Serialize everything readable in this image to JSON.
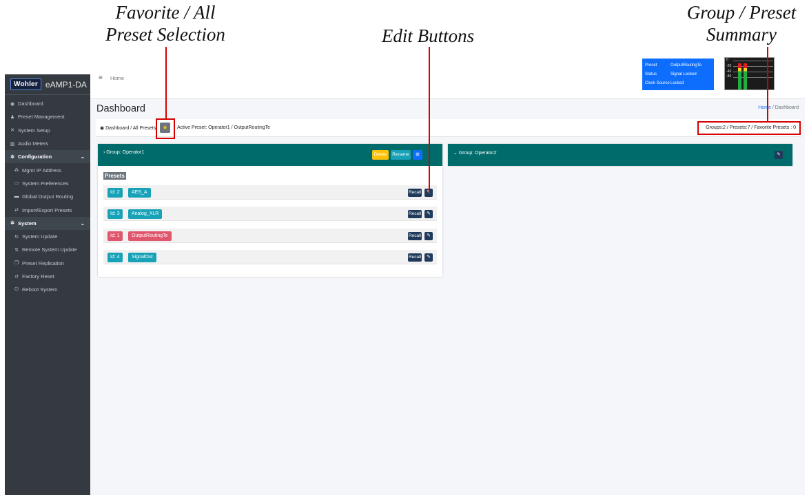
{
  "annotations": {
    "favorite_line1": "Favorite / All",
    "favorite_line2": "Preset Selection",
    "edit": "Edit Buttons",
    "summary_line1": "Group / Preset",
    "summary_line2": "Summary"
  },
  "brand": {
    "logo": "Wohler",
    "product": "eAMP1-DA"
  },
  "sidebar": {
    "items": [
      {
        "label": "Dashboard",
        "icon": "dashboard-icon",
        "glyph": "◉"
      },
      {
        "label": "Preset Management",
        "icon": "users-icon",
        "glyph": "♟"
      },
      {
        "label": "System Setup",
        "icon": "tools-icon",
        "glyph": "✕"
      },
      {
        "label": "Audio Meters",
        "icon": "chart-icon",
        "glyph": "▥"
      }
    ],
    "configuration": {
      "label": "Configuration",
      "items": [
        {
          "label": "Mgmt IP Address",
          "icon": "network-icon",
          "glyph": "⁂"
        },
        {
          "label": "System Preferences",
          "icon": "toggle-icon",
          "glyph": "▭"
        },
        {
          "label": "Global Output Routing",
          "icon": "keyboard-icon",
          "glyph": "▬"
        },
        {
          "label": "Import/Export Presets",
          "icon": "exchange-icon",
          "glyph": "⇄"
        }
      ]
    },
    "system": {
      "label": "System",
      "items": [
        {
          "label": "System Update",
          "icon": "sync-icon",
          "glyph": "↻"
        },
        {
          "label": "Remote System Update",
          "icon": "tower-icon",
          "glyph": "⇅"
        },
        {
          "label": "Preset Replication",
          "icon": "copy-icon",
          "glyph": "❐"
        },
        {
          "label": "Factory Reset",
          "icon": "undo-icon",
          "glyph": "↺"
        },
        {
          "label": "Reboot System",
          "icon": "power-icon",
          "glyph": "⏻"
        }
      ]
    }
  },
  "topbar": {
    "home": "Home"
  },
  "status": {
    "preset_label": "Preset",
    "preset_value": "OutputRoutingTe",
    "status_label": "Status",
    "status_value": "Signal Locked",
    "clock_label": "Clock Source",
    "clock_value": "Locked"
  },
  "meter": {
    "labels": [
      "0",
      "-20",
      "-40",
      "-80"
    ],
    "left_level": 0.82,
    "right_level": 0.82
  },
  "page": {
    "title": "Dashboard",
    "crumb_home": "Home",
    "crumb_sep": " / ",
    "crumb_current": "Dashboard"
  },
  "infobar": {
    "breadcrumb": "Dashboard / All Presets",
    "active_preset": "Active Preset: Operator1 / OutputRoutingTe",
    "summary": "Groups:2 / Presets:7 / Favorite Presets : 0"
  },
  "group1": {
    "title": "Group: Operator1",
    "delete": "Delete",
    "rename": "Rename",
    "presets_label": "Presets",
    "recall": "Recall",
    "presets": [
      {
        "id": "Id: 2",
        "name": "AES_A",
        "active": false
      },
      {
        "id": "Id: 3",
        "name": "Analog_XLR",
        "active": false
      },
      {
        "id": "Id: 1",
        "name": "OutputRoutingTe",
        "active": true
      },
      {
        "id": "Id: 4",
        "name": "SignalOut",
        "active": false
      }
    ]
  },
  "group2": {
    "title": "Group: Operator2"
  },
  "colors": {
    "accent": "#006b6b",
    "teal_badge": "#17a2b8",
    "active_badge": "#e0566c",
    "delete": "#ffc107",
    "annotation": "#d40000"
  }
}
